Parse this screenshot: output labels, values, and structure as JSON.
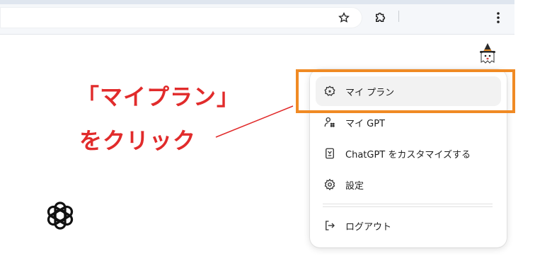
{
  "annotation": {
    "line1": "「マイプラン」",
    "line2": "をクリック",
    "color": "#e12b2b"
  },
  "highlight_color": "#f08a24",
  "toolbar": {
    "icons": [
      "star-icon",
      "extensions-icon",
      "kebab-menu-icon"
    ]
  },
  "menu": {
    "items": [
      {
        "label": "マイ プラン",
        "icon": "plan-icon"
      },
      {
        "label": "マイ GPT",
        "icon": "gpt-users-icon"
      },
      {
        "label": "ChatGPT をカスタマイズする",
        "icon": "customize-icon"
      },
      {
        "label": "設定",
        "icon": "settings-gear-icon"
      },
      {
        "label": "ログアウト",
        "icon": "logout-icon"
      }
    ]
  }
}
